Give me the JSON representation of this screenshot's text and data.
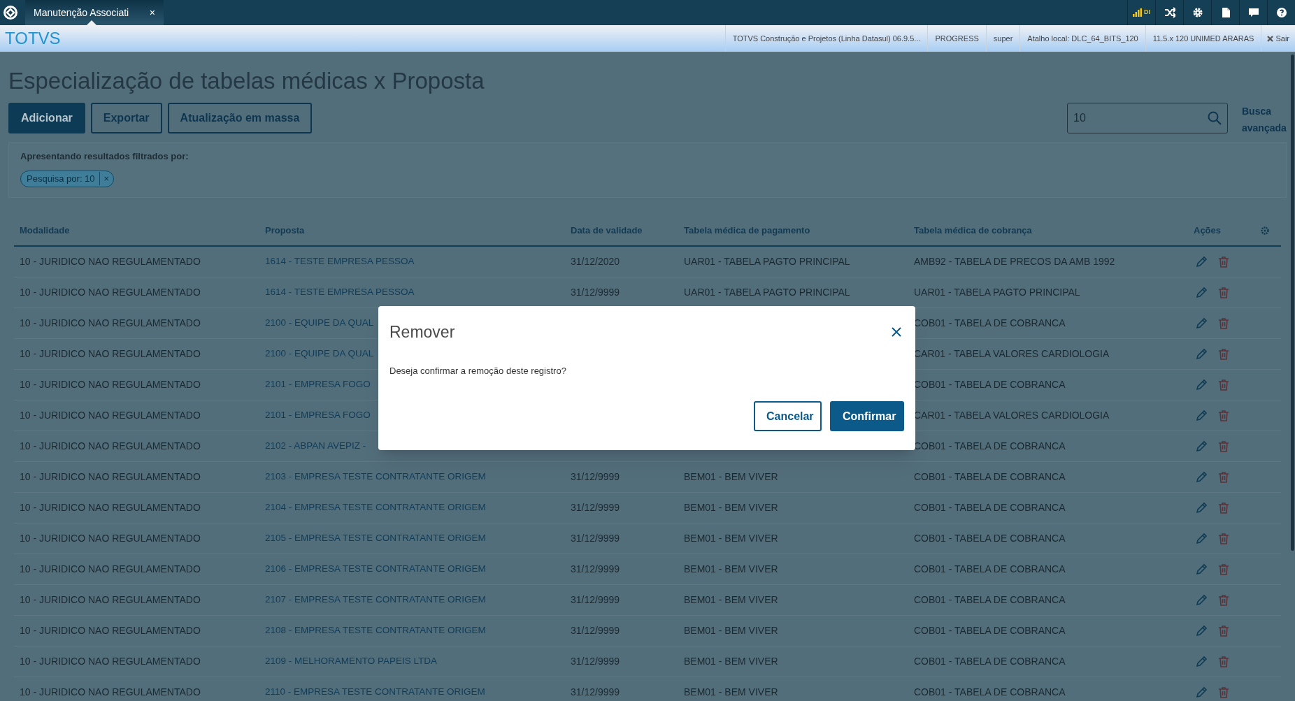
{
  "top_bar": {
    "tab": {
      "label": "Manutenção Associati",
      "close": "×"
    },
    "status_badge": "DI"
  },
  "header": {
    "brand": "TOTVS",
    "info": [
      "TOTVS Construção e Projetos (Linha Datasul) 06.9.5...",
      "PROGRESS",
      "super",
      "Atalho local: DLC_64_BITS_120",
      "11.5.x 120 UNIMED ARARAS"
    ],
    "logout": "Sair"
  },
  "page": {
    "title": "Especialização de tabelas médicas x Proposta",
    "buttons": [
      {
        "label": "Adicionar",
        "kind": "primary"
      },
      {
        "label": "Exportar",
        "kind": "secondary"
      },
      {
        "label": "Atualização em massa",
        "kind": "secondary"
      }
    ],
    "search": {
      "value": "10"
    },
    "advanced_search": "Busca avançada",
    "filter": {
      "label": "Apresentando resultados filtrados por:",
      "chips": [
        {
          "label": "Pesquisa por: 10",
          "remove": "×"
        }
      ]
    }
  },
  "table": {
    "columns": [
      "Modalidade",
      "Proposta",
      "Data de validade",
      "Tabela médica de pagamento",
      "Tabela médica de cobrança",
      "Ações"
    ],
    "rows": [
      {
        "modalidade": "10 - JURIDICO NAO REGULAMENTADO",
        "proposta": "1614 - TESTE EMPRESA PESSOA",
        "data": "31/12/2020",
        "pagamento": "UAR01 - TABELA PAGTO PRINCIPAL",
        "cobranca": "AMB92 - TABELA DE PRECOS DA AMB 1992"
      },
      {
        "modalidade": "10 - JURIDICO NAO REGULAMENTADO",
        "proposta": "1614 - TESTE EMPRESA PESSOA",
        "data": "31/12/9999",
        "pagamento": "UAR01 - TABELA PAGTO PRINCIPAL",
        "cobranca": "UAR01 - TABELA PAGTO PRINCIPAL"
      },
      {
        "modalidade": "10 - JURIDICO NAO REGULAMENTADO",
        "proposta": "2100 - EQUIPE DA QUAL",
        "cobranca": "COB01 - TABELA DE COBRANCA"
      },
      {
        "modalidade": "10 - JURIDICO NAO REGULAMENTADO",
        "proposta": "2100 - EQUIPE DA QUAL",
        "cobranca": "CAR01 - TABELA VALORES CARDIOLOGIA"
      },
      {
        "modalidade": "10 - JURIDICO NAO REGULAMENTADO",
        "proposta": "2101 - EMPRESA FOGO",
        "cobranca": "COB01 - TABELA DE COBRANCA"
      },
      {
        "modalidade": "10 - JURIDICO NAO REGULAMENTADO",
        "proposta": "2101 - EMPRESA FOGO",
        "cobranca": "CAR01 - TABELA VALORES CARDIOLOGIA"
      },
      {
        "modalidade": "10 - JURIDICO NAO REGULAMENTADO",
        "proposta": "2102 - ABPAN AVEPIZ -",
        "cobranca": "COB01 - TABELA DE COBRANCA"
      },
      {
        "modalidade": "10 - JURIDICO NAO REGULAMENTADO",
        "proposta": "2103 - EMPRESA TESTE CONTRATANTE ORIGEM",
        "data": "31/12/9999",
        "pagamento": "BEM01 - BEM VIVER",
        "cobranca": "COB01 - TABELA DE COBRANCA"
      },
      {
        "modalidade": "10 - JURIDICO NAO REGULAMENTADO",
        "proposta": "2104 - EMPRESA TESTE CONTRATANTE ORIGEM",
        "data": "31/12/9999",
        "pagamento": "BEM01 - BEM VIVER",
        "cobranca": "COB01 - TABELA DE COBRANCA"
      },
      {
        "modalidade": "10 - JURIDICO NAO REGULAMENTADO",
        "proposta": "2105 - EMPRESA TESTE CONTRATANTE ORIGEM",
        "data": "31/12/9999",
        "pagamento": "BEM01 - BEM VIVER",
        "cobranca": "COB01 - TABELA DE COBRANCA"
      },
      {
        "modalidade": "10 - JURIDICO NAO REGULAMENTADO",
        "proposta": "2106 - EMPRESA TESTE CONTRATANTE ORIGEM",
        "data": "31/12/9999",
        "pagamento": "BEM01 - BEM VIVER",
        "cobranca": "COB01 - TABELA DE COBRANCA"
      },
      {
        "modalidade": "10 - JURIDICO NAO REGULAMENTADO",
        "proposta": "2107 - EMPRESA TESTE CONTRATANTE ORIGEM",
        "data": "31/12/9999",
        "pagamento": "BEM01 - BEM VIVER",
        "cobranca": "COB01 - TABELA DE COBRANCA"
      },
      {
        "modalidade": "10 - JURIDICO NAO REGULAMENTADO",
        "proposta": "2108 - EMPRESA TESTE CONTRATANTE ORIGEM",
        "data": "31/12/9999",
        "pagamento": "BEM01 - BEM VIVER",
        "cobranca": "COB01 - TABELA DE COBRANCA"
      },
      {
        "modalidade": "10 - JURIDICO NAO REGULAMENTADO",
        "proposta": "2109 - MELHORAMENTO PAPEIS LTDA",
        "data": "31/12/9999",
        "pagamento": "BEM01 - BEM VIVER",
        "cobranca": "COB01 - TABELA DE COBRANCA"
      },
      {
        "modalidade": "10 - JURIDICO NAO REGULAMENTADO",
        "proposta": "2110 - EMPRESA TESTE CONTRATANTE ORIGEM",
        "data": "31/12/9999",
        "pagamento": "BEM01 - BEM VIVER",
        "cobranca": "COB01 - TABELA DE COBRANCA"
      }
    ]
  },
  "dialog": {
    "title": "Remover",
    "message": "Deseja confirmar a remoção deste registro?",
    "buttons": [
      {
        "label": "Cancelar",
        "kind": "secondary"
      },
      {
        "label": "Confirmar",
        "kind": "primary"
      }
    ]
  }
}
